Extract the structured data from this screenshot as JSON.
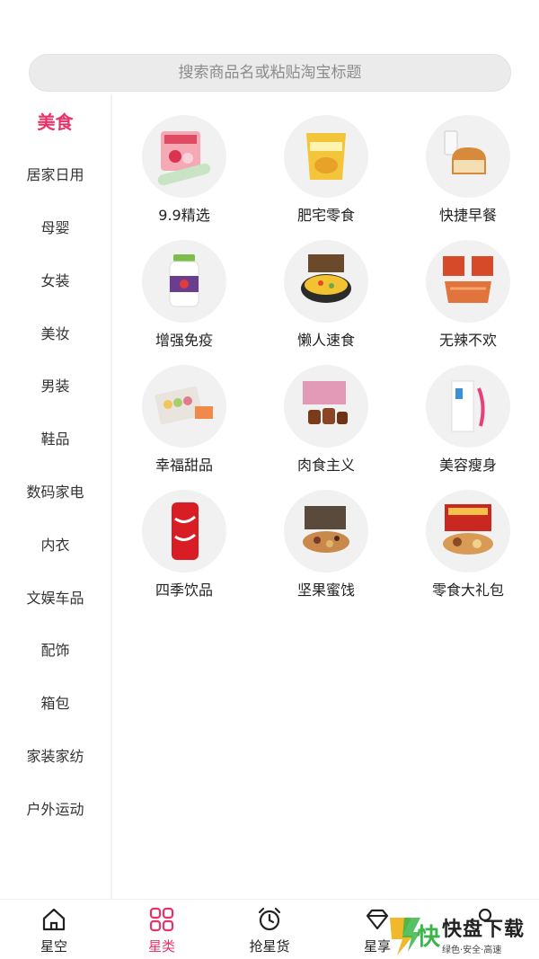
{
  "search": {
    "placeholder": "搜索商品名或粘贴淘宝标题"
  },
  "sidebar": {
    "items": [
      {
        "label": "美食",
        "active": true
      },
      {
        "label": "居家日用"
      },
      {
        "label": "母婴"
      },
      {
        "label": "女装"
      },
      {
        "label": "美妆"
      },
      {
        "label": "男装"
      },
      {
        "label": "鞋品"
      },
      {
        "label": "数码家电"
      },
      {
        "label": "内衣"
      },
      {
        "label": "文娱车品"
      },
      {
        "label": "配饰"
      },
      {
        "label": "箱包"
      },
      {
        "label": "家装家纺"
      },
      {
        "label": "户外运动"
      }
    ]
  },
  "grid": {
    "items": [
      {
        "label": "9.9精选",
        "icon": "snack-pack-icon"
      },
      {
        "label": "肥宅零食",
        "icon": "chips-bag-icon"
      },
      {
        "label": "快捷早餐",
        "icon": "bread-milk-icon"
      },
      {
        "label": "增强免疫",
        "icon": "supplement-bottle-icon"
      },
      {
        "label": "懒人速食",
        "icon": "noodle-bowl-icon"
      },
      {
        "label": "无辣不欢",
        "icon": "spicy-strips-icon"
      },
      {
        "label": "幸福甜品",
        "icon": "macaron-box-icon"
      },
      {
        "label": "肉食主义",
        "icon": "braised-meat-icon"
      },
      {
        "label": "美容瘦身",
        "icon": "slimming-box-icon"
      },
      {
        "label": "四季饮品",
        "icon": "cola-can-icon"
      },
      {
        "label": "坚果蜜饯",
        "icon": "nuts-box-icon"
      },
      {
        "label": "零食大礼包",
        "icon": "gift-pack-icon"
      }
    ]
  },
  "tabbar": {
    "items": [
      {
        "label": "星空",
        "icon": "home-icon"
      },
      {
        "label": "星类",
        "icon": "category-grid-icon",
        "active": true
      },
      {
        "label": "抢星货",
        "icon": "alarm-clock-icon"
      },
      {
        "label": "星享",
        "icon": "diamond-icon"
      },
      {
        "label": "",
        "icon": "user-icon"
      }
    ]
  },
  "watermark": {
    "main": "快盘下载",
    "sub": "绿色·安全·高速"
  },
  "colors": {
    "accent": "#e8336a",
    "searchBg": "#ebebeb",
    "tileBg": "#f1f1f1"
  }
}
